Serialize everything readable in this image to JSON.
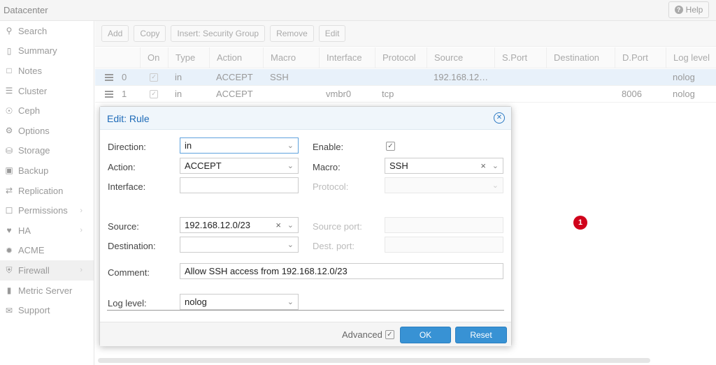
{
  "topbar": {
    "title": "Datacenter",
    "help_label": "Help"
  },
  "sidebar": {
    "items": [
      {
        "label": "Search",
        "icon": "search-icon"
      },
      {
        "label": "Summary",
        "icon": "book-icon"
      },
      {
        "label": "Notes",
        "icon": "notes-icon"
      },
      {
        "label": "Cluster",
        "icon": "server-icon"
      },
      {
        "label": "Ceph",
        "icon": "ceph-icon"
      },
      {
        "label": "Options",
        "icon": "gear-icon"
      },
      {
        "label": "Storage",
        "icon": "database-icon"
      },
      {
        "label": "Backup",
        "icon": "floppy-icon"
      },
      {
        "label": "Replication",
        "icon": "retweet-icon"
      },
      {
        "label": "Permissions",
        "icon": "unlock-icon"
      },
      {
        "label": "HA",
        "icon": "heartbeat-icon"
      },
      {
        "label": "ACME",
        "icon": "certificate-icon"
      },
      {
        "label": "Firewall",
        "icon": "shield-icon"
      },
      {
        "label": "Metric Server",
        "icon": "bar-chart-icon"
      },
      {
        "label": "Support",
        "icon": "comments-icon"
      }
    ]
  },
  "toolbar": {
    "buttons": [
      "Add",
      "Copy",
      "Insert: Security Group",
      "Remove",
      "Edit"
    ]
  },
  "grid": {
    "columns": [
      "On",
      "Type",
      "Action",
      "Macro",
      "Interface",
      "Protocol",
      "Source",
      "S.Port",
      "Destination",
      "D.Port",
      "Log level"
    ],
    "rows": [
      {
        "index": "0",
        "type": "in",
        "action": "ACCEPT",
        "macro": "SSH",
        "interface": "",
        "protocol": "",
        "source": "192.168.12…",
        "sport": "",
        "destination": "",
        "dport": "",
        "log": "nolog"
      },
      {
        "index": "1",
        "type": "in",
        "action": "ACCEPT",
        "macro": "",
        "interface": "vmbr0",
        "protocol": "tcp",
        "source": "",
        "sport": "",
        "destination": "",
        "dport": "8006",
        "log": "nolog"
      }
    ]
  },
  "badge": "1",
  "dialog": {
    "title": "Edit: Rule",
    "labels": {
      "direction": "Direction:",
      "action": "Action:",
      "interface": "Interface:",
      "enable": "Enable:",
      "macro": "Macro:",
      "protocol": "Protocol:",
      "source": "Source:",
      "destination": "Destination:",
      "source_port": "Source port:",
      "dest_port": "Dest. port:",
      "comment": "Comment:",
      "log_level": "Log level:"
    },
    "values": {
      "direction": "in",
      "action": "ACCEPT",
      "interface": "",
      "macro": "SSH",
      "protocol": "",
      "source": "192.168.12.0/23",
      "destination": "",
      "source_port": "",
      "dest_port": "",
      "comment": "Allow SSH access from 192.168.12.0/23",
      "log_level": "nolog"
    },
    "advanced_label": "Advanced",
    "ok_label": "OK",
    "reset_label": "Reset"
  },
  "colors": {
    "accent": "#3892d4",
    "title": "#1e6bb8",
    "badge": "#d0021b"
  }
}
